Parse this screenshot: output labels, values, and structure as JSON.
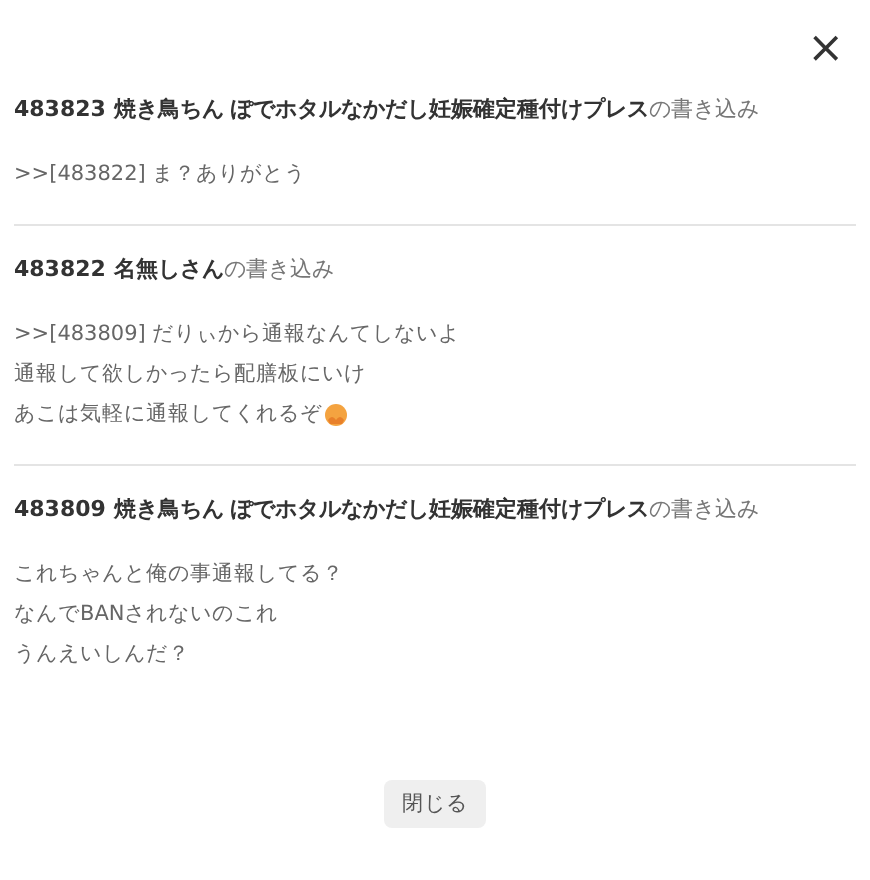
{
  "close_symbol": "×",
  "posts": [
    {
      "number": "483823",
      "name": "焼き鳥ちん ぽでホタルなかだし妊娠確定種付けプレス",
      "suffix": "の書き込み",
      "lines": [
        {
          "text": ">>[483822] ま？ありがとう",
          "emoji": false
        }
      ]
    },
    {
      "number": "483822",
      "name": "名無しさん",
      "suffix": "の書き込み",
      "lines": [
        {
          "text": ">>[483809] だりぃから通報なんてしないよ",
          "emoji": false
        },
        {
          "text": "通報して欲しかったら配膳板にいけ",
          "emoji": false
        },
        {
          "text": "あこは気軽に通報してくれるぞ",
          "emoji": true
        }
      ]
    },
    {
      "number": "483809",
      "name": "焼き鳥ちん ぽでホタルなかだし妊娠確定種付けプレス",
      "suffix": "の書き込み",
      "lines": [
        {
          "text": "これちゃんと俺の事通報してる？",
          "emoji": false
        },
        {
          "text": "なんでBANされないのこれ",
          "emoji": false
        },
        {
          "text": "うんえいしんだ？",
          "emoji": false
        }
      ]
    }
  ],
  "button": "閉じる"
}
